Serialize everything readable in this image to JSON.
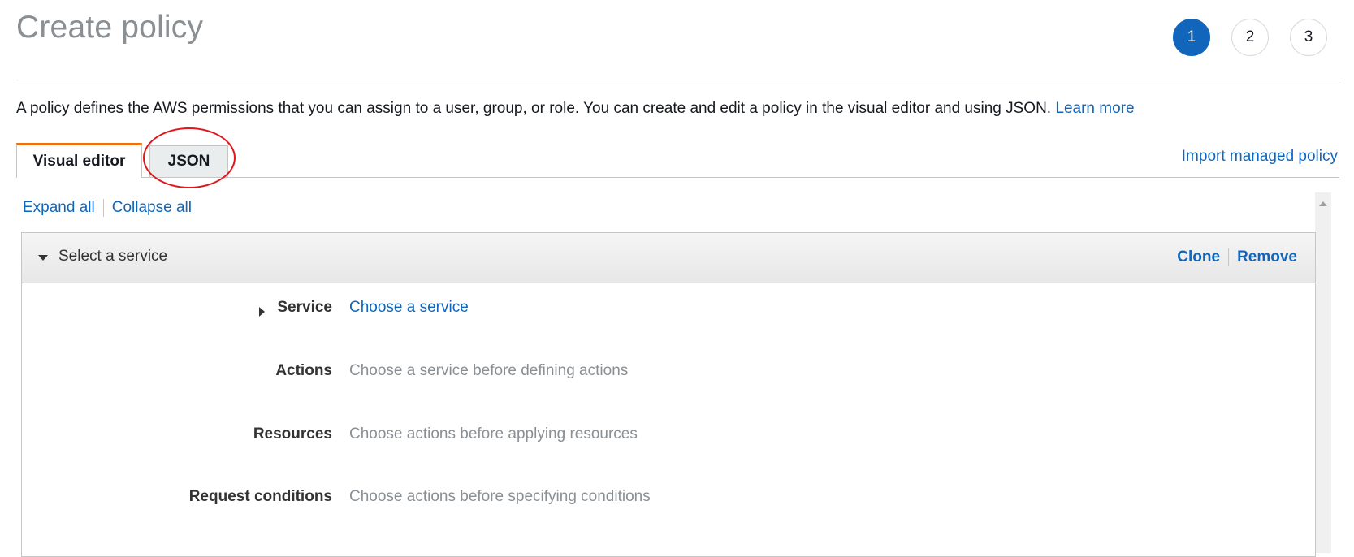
{
  "header": {
    "title": "Create policy",
    "steps": [
      "1",
      "2",
      "3"
    ],
    "active_step": "1"
  },
  "description": {
    "text": "A policy defines the AWS permissions that you can assign to a user, group, or role. You can create and edit a policy in the visual editor and using JSON.",
    "learn_more": "Learn more"
  },
  "tabs": [
    {
      "label": "Visual editor",
      "active": true
    },
    {
      "label": "JSON",
      "active": false
    }
  ],
  "import_link": "Import managed policy",
  "expand_all": "Expand all",
  "collapse_all": "Collapse all",
  "statement": {
    "title": "Select a service",
    "clone": "Clone",
    "remove": "Remove",
    "rows": [
      {
        "label": "Service",
        "value": "Choose a service"
      },
      {
        "label": "Actions",
        "value": "Choose a service before defining actions"
      },
      {
        "label": "Resources",
        "value": "Choose actions before applying resources"
      },
      {
        "label": "Request conditions",
        "value": "Choose actions before specifying conditions"
      }
    ]
  },
  "colors": {
    "accent_link": "#1166bb",
    "active_tab_border": "#ec7211",
    "annotation": "#e0161a",
    "active_step": "#1166bb"
  }
}
